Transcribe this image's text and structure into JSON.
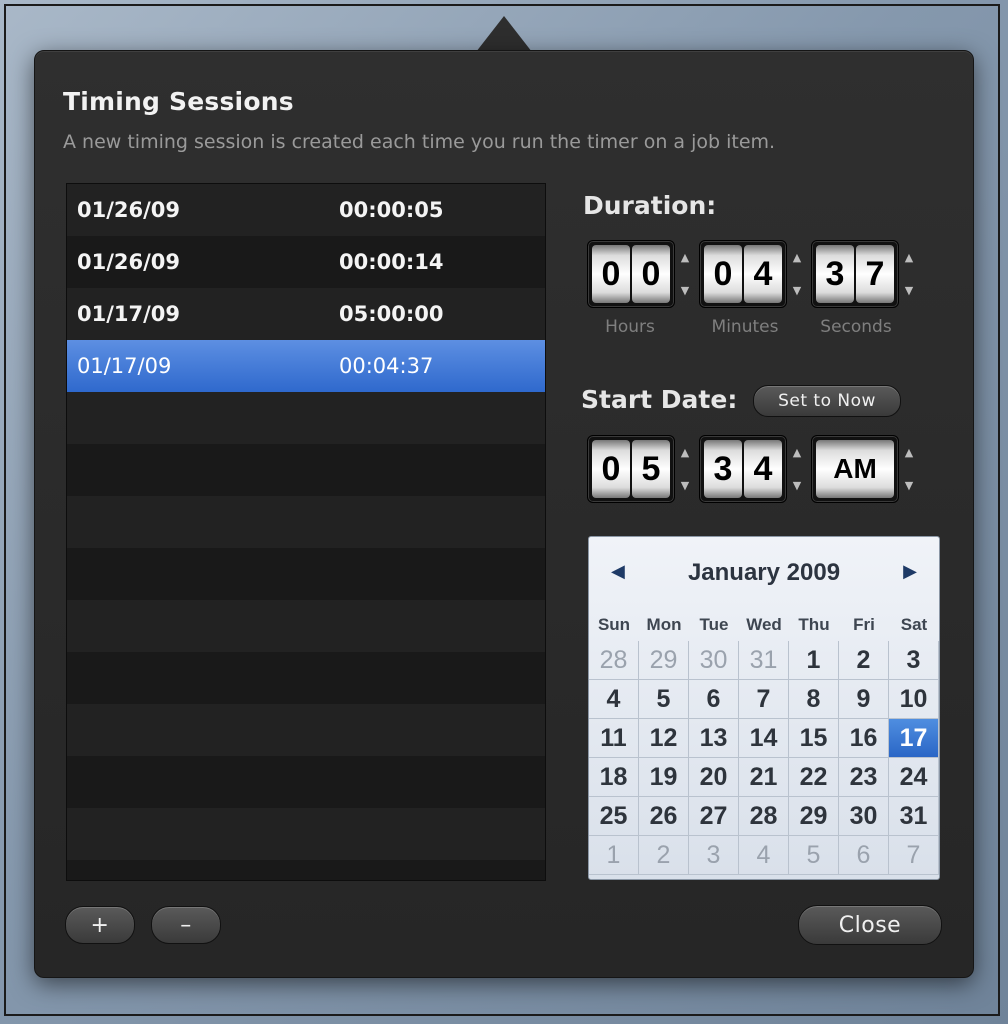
{
  "header": {
    "title": "Timing Sessions",
    "subtitle": "A new timing session is created each time you run the timer on a job item."
  },
  "sessions": [
    {
      "date": "01/26/09",
      "duration": "00:00:05",
      "selected": false
    },
    {
      "date": "01/26/09",
      "duration": "00:00:14",
      "selected": false
    },
    {
      "date": "01/17/09",
      "duration": "05:00:00",
      "selected": false
    },
    {
      "date": "01/17/09",
      "duration": "00:04:37",
      "selected": true
    }
  ],
  "duration": {
    "label": "Duration:",
    "hours": [
      "0",
      "0"
    ],
    "minutes": [
      "0",
      "4"
    ],
    "seconds": [
      "3",
      "7"
    ],
    "hours_label": "Hours",
    "minutes_label": "Minutes",
    "seconds_label": "Seconds"
  },
  "start_date": {
    "label": "Start Date:",
    "set_now_label": "Set to Now",
    "hour": [
      "0",
      "5"
    ],
    "minute": [
      "3",
      "4"
    ],
    "ampm": "AM"
  },
  "calendar": {
    "title": "January 2009",
    "prev_icon": "◀",
    "next_icon": "▶",
    "weekdays": [
      "Sun",
      "Mon",
      "Tue",
      "Wed",
      "Thu",
      "Fri",
      "Sat"
    ],
    "weeks": [
      [
        "28",
        "29",
        "30",
        "31",
        "1",
        "2",
        "3"
      ],
      [
        "4",
        "5",
        "6",
        "7",
        "8",
        "9",
        "10"
      ],
      [
        "11",
        "12",
        "13",
        "14",
        "15",
        "16",
        "17"
      ],
      [
        "18",
        "19",
        "20",
        "21",
        "22",
        "23",
        "24"
      ],
      [
        "25",
        "26",
        "27",
        "28",
        "29",
        "30",
        "31"
      ],
      [
        "1",
        "2",
        "3",
        "4",
        "5",
        "6",
        "7"
      ]
    ],
    "selected_day": "17"
  },
  "buttons": {
    "add": "+",
    "remove": "–",
    "close": "Close"
  },
  "arrows": {
    "up": "▲",
    "down": "▼"
  }
}
